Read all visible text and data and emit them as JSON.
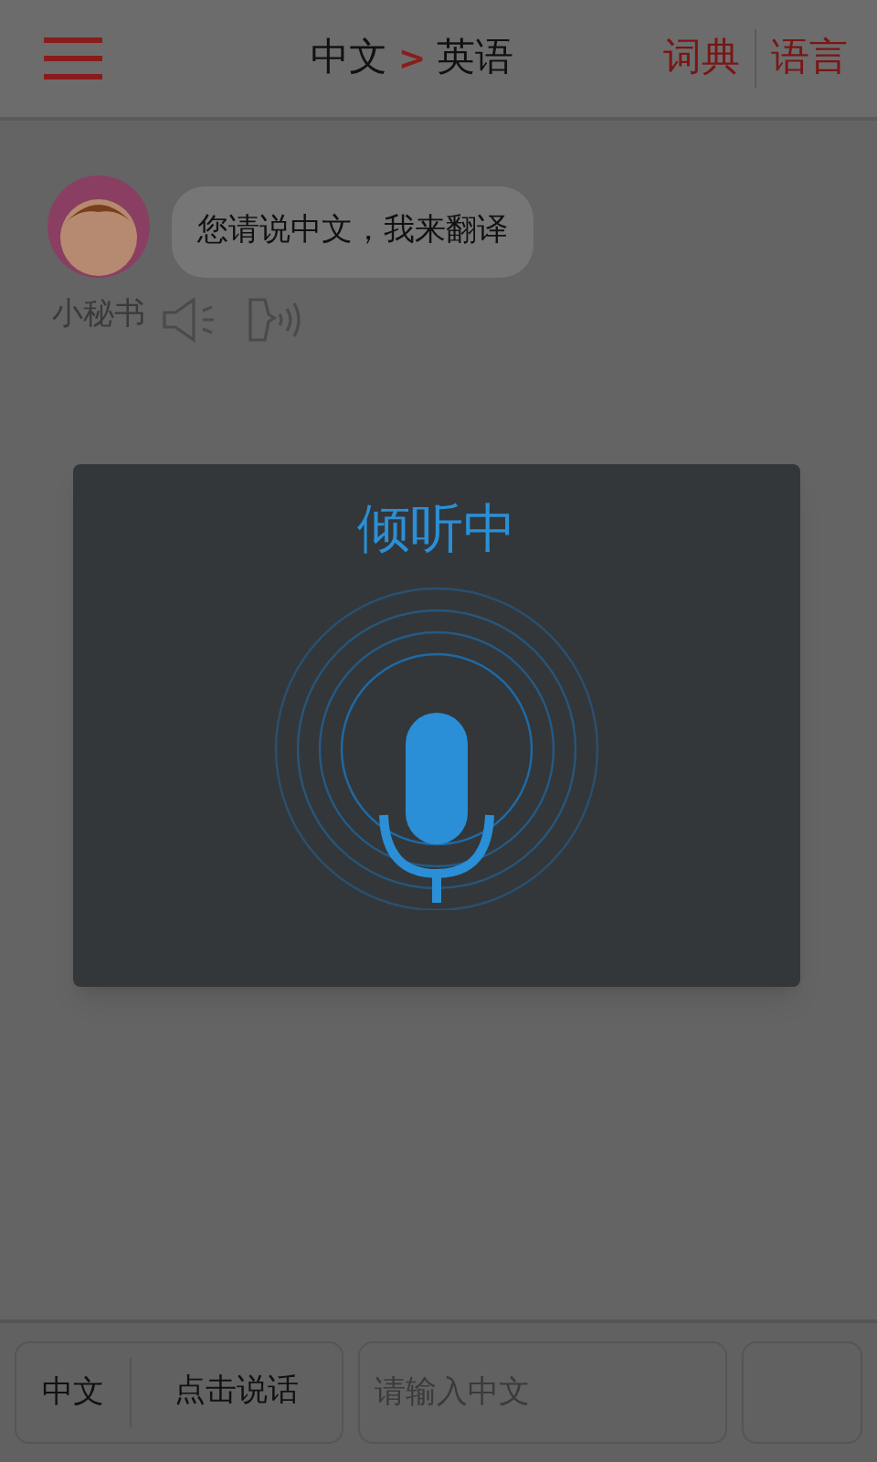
{
  "header": {
    "source_language": "中文",
    "arrow": ">",
    "target_language": "英语",
    "actions": [
      "词典",
      "语言"
    ]
  },
  "chat": {
    "messages": [
      {
        "sender": "小秘书",
        "text": "您请说中文，我来翻译"
      }
    ]
  },
  "dialog": {
    "title": "倾听中"
  },
  "bottom_bar": {
    "language": "中文",
    "speak_button": "点击说话",
    "input": {
      "placeholder": "请输入中文"
    }
  }
}
